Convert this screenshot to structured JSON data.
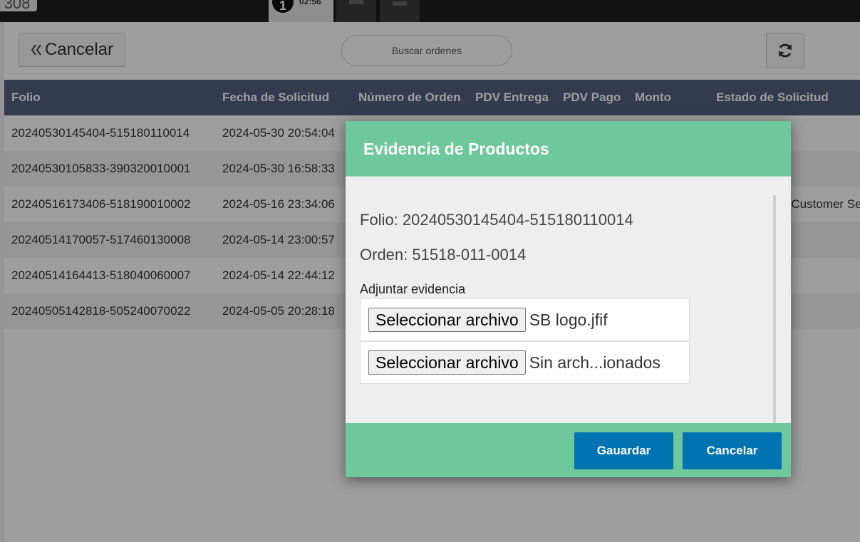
{
  "topbar": {
    "logo_text": "308",
    "badge_text": "1",
    "timer": "02:56",
    "add_icon": "plus-icon",
    "remove_icon": "minus-icon"
  },
  "toolbar": {
    "cancel_icon": "double-chevron-left-icon",
    "cancel_label": "Cancelar",
    "search_placeholder": "Buscar ordenes",
    "refresh_icon": "refresh-icon"
  },
  "table": {
    "headers": [
      "Folio",
      "Fecha de Solicitud",
      "Número de Orden",
      "PDV Entrega",
      "PDV Pago",
      "Monto",
      "Estado de Solicitud"
    ],
    "rows": [
      {
        "folio": "20240530145404-515180110014",
        "fecha": "2024-05-30 20:54:04",
        "estado": ""
      },
      {
        "folio": "20240530105833-390320010001",
        "fecha": "2024-05-30 16:58:33",
        "estado": ""
      },
      {
        "folio": "20240516173406-518190010002",
        "fecha": "2024-05-16 23:34:06",
        "estado": "r Customer Se"
      },
      {
        "folio": "20240514170057-517460130008",
        "fecha": "2024-05-14 23:00:57",
        "estado": ""
      },
      {
        "folio": "20240514164413-518040060007",
        "fecha": "2024-05-14 22:44:12",
        "estado": ""
      },
      {
        "folio": "20240505142818-505240070022",
        "fecha": "2024-05-05 20:28:18",
        "estado": ""
      }
    ]
  },
  "modal": {
    "title": "Evidencia de Productos",
    "folio_line": "Folio: 20240530145404-515180110014",
    "orden_line": "Orden: 51518-011-0014",
    "attach_label": "Adjuntar evidencia",
    "files": [
      {
        "button": "Seleccionar archivo",
        "name": "SB logo.jfif"
      },
      {
        "button": "Seleccionar archivo",
        "name": "Sin arch...ionados"
      }
    ],
    "save_label": "Gauardar",
    "cancel_label": "Cancelar"
  },
  "colors": {
    "header_bg": "#556080",
    "modal_accent": "#6fc79c",
    "primary_button": "#0073b0"
  }
}
